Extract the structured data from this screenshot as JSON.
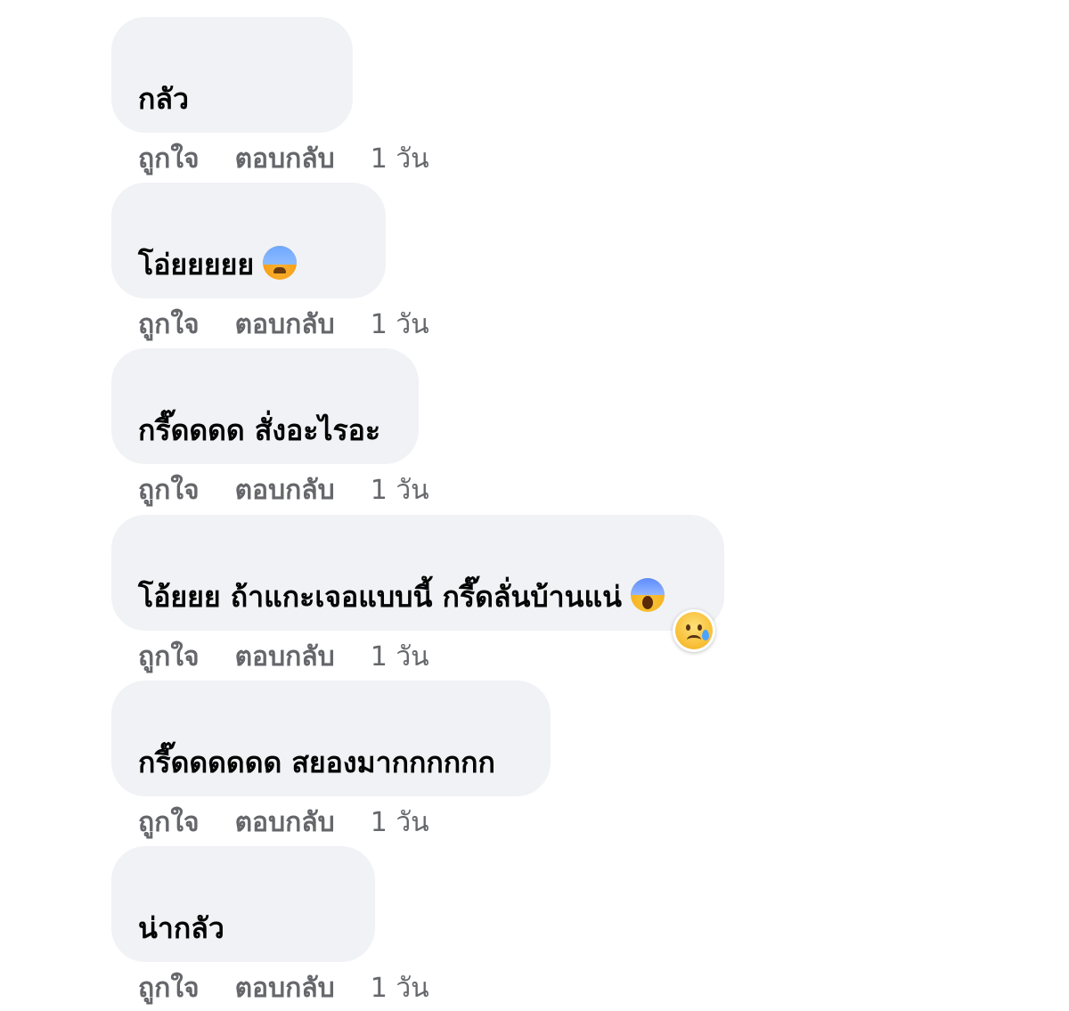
{
  "actions": {
    "like_label": "ถูกใจ",
    "reply_label": "ตอบกลับ",
    "time_label": "1 วัน"
  },
  "comments": [
    {
      "text": "กลัว",
      "emoji": ""
    },
    {
      "text": "โอ่ยยยยย",
      "emoji": "anxious-face-with-sweat-icon"
    },
    {
      "text": "กรี๊ดดดด สั่งอะไรอะ",
      "emoji": ""
    },
    {
      "text": "โอ้ยยย ถ้าแกะเจอแบบนี้ กรี๊ดลั่นบ้านแน่",
      "emoji": "face-screaming-in-fear-icon",
      "reaction": "sad-reaction-icon"
    },
    {
      "text": "กรี๊ดดดดดด สยองมากกกกกก",
      "emoji": ""
    },
    {
      "text": "น่ากลัว",
      "emoji": ""
    }
  ],
  "colors": {
    "bubble_bg": "#f0f2f5",
    "text": "#050505",
    "meta": "#65676b"
  }
}
